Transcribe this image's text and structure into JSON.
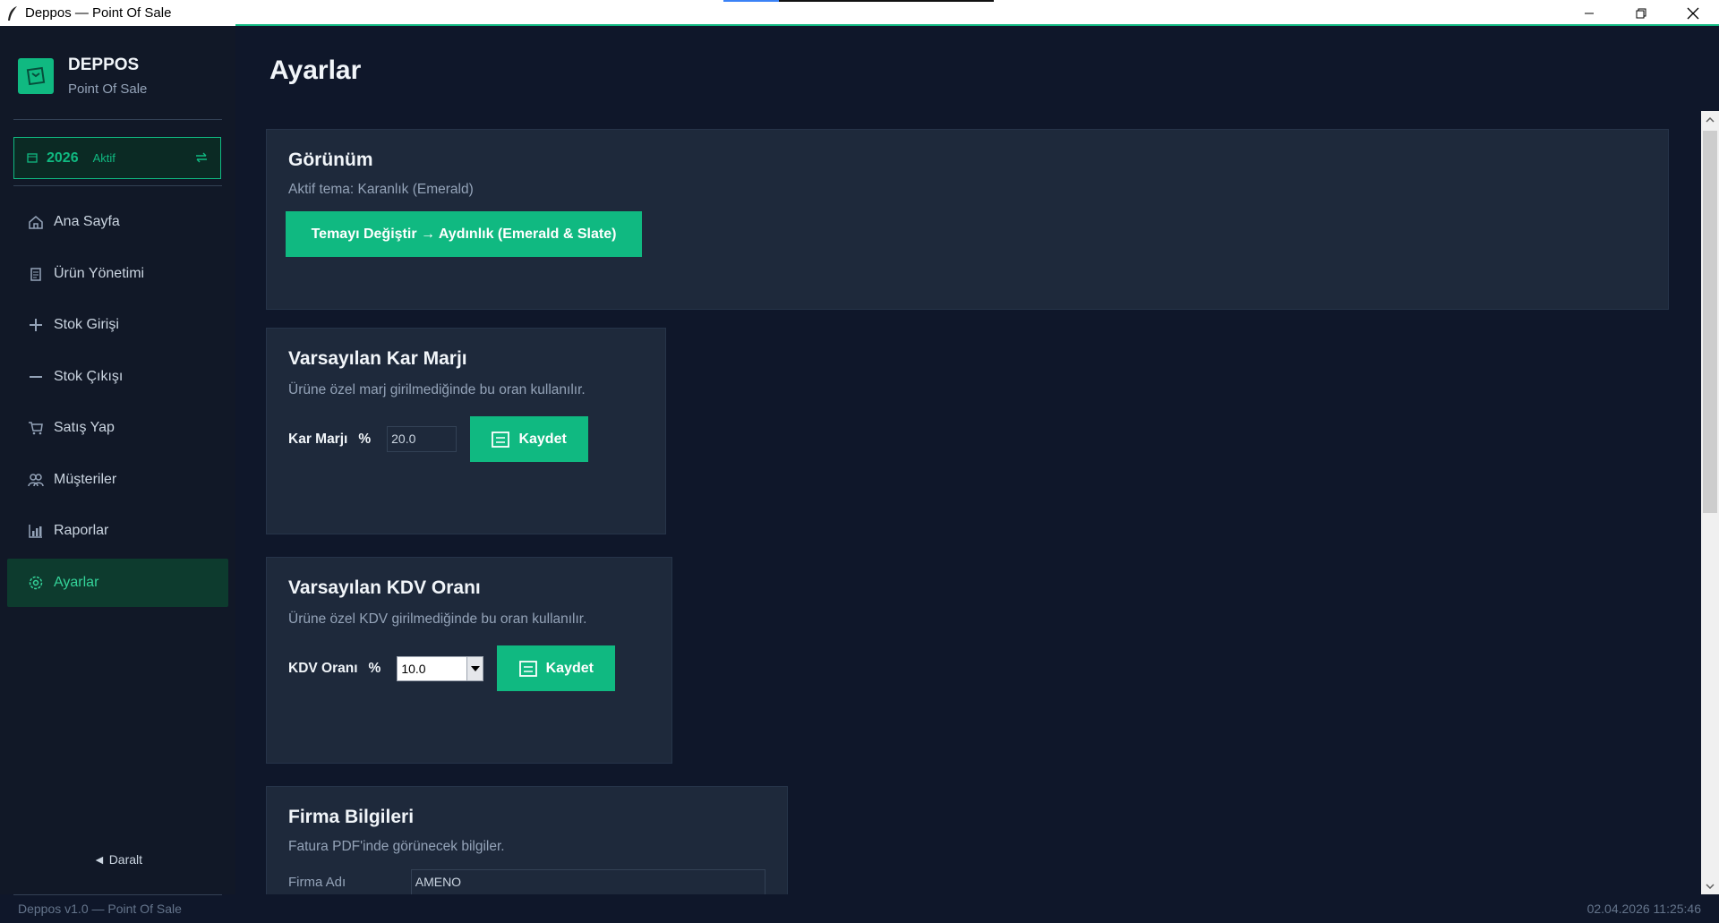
{
  "window": {
    "title": "Deppos — Point Of Sale"
  },
  "brand": {
    "name": "DEPPOS",
    "subtitle": "Point Of Sale"
  },
  "year_box": {
    "year": "2026",
    "status": "Aktif"
  },
  "sidebar": {
    "items": [
      {
        "label": "Ana Sayfa",
        "icon": "home-icon"
      },
      {
        "label": "Ürün Yönetimi",
        "icon": "clipboard-icon"
      },
      {
        "label": "Stok Girişi",
        "icon": "plus-icon"
      },
      {
        "label": "Stok Çıkışı",
        "icon": "minus-icon"
      },
      {
        "label": "Satış Yap",
        "icon": "cart-icon"
      },
      {
        "label": "Müşteriler",
        "icon": "users-icon"
      },
      {
        "label": "Raporlar",
        "icon": "bar-chart-icon"
      },
      {
        "label": "Ayarlar",
        "icon": "gear-icon",
        "active": true
      }
    ],
    "collapse_label": "◄ Daralt"
  },
  "page": {
    "title": "Ayarlar"
  },
  "appearance": {
    "title": "Görünüm",
    "desc": "Aktif tema: Karanlık (Emerald)",
    "button": "Temayı Değiştir → Aydınlık (Emerald & Slate)"
  },
  "margin": {
    "title": "Varsayılan Kar Marjı",
    "desc": "Ürüne özel marj girilmediğinde bu oran kullanılır.",
    "label": "Kar Marjı",
    "unit": "%",
    "value": "20.0",
    "save": "Kaydet"
  },
  "vat": {
    "title": "Varsayılan KDV Oranı",
    "desc": "Ürüne özel KDV girilmediğinde bu oran kullanılır.",
    "label": "KDV Oranı",
    "unit": "%",
    "value": "10.0",
    "save": "Kaydet"
  },
  "company": {
    "title": "Firma Bilgileri",
    "desc": "Fatura PDF'inde görünecek bilgiler.",
    "name_label": "Firma Adı",
    "name_value": "AMENO"
  },
  "footer": {
    "left": "Deppos v1.0 — Point Of Sale",
    "right": "02.04.2026 11:25:46"
  },
  "colors": {
    "accent": "#10b981",
    "bg": "#0f172a",
    "card": "#1e293b",
    "sidebar": "#111827"
  }
}
